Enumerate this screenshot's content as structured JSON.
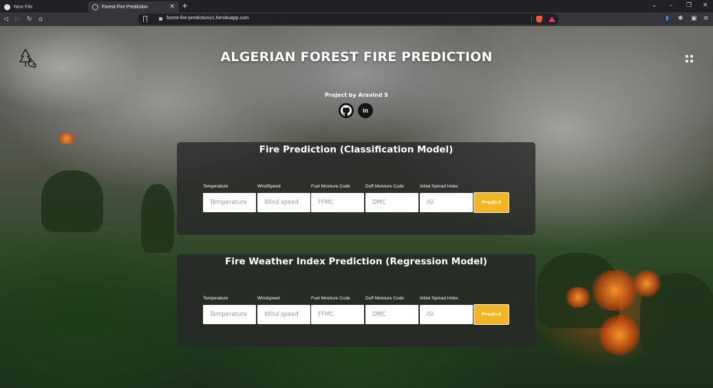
{
  "browser": {
    "tabs": [
      {
        "label": "New File",
        "icon": "github-icon",
        "active": false
      },
      {
        "label": "Forest Fire Prediction",
        "icon": "globe-icon",
        "active": true
      }
    ],
    "url": "forest-fire-predictionv1.herokuapp.com",
    "nav_icons": [
      "back-icon",
      "forward-icon",
      "reload-icon",
      "home-icon",
      "bookmark-icon",
      "lock-icon"
    ],
    "extension_icons": [
      "brave-shields-icon",
      "brave-rewards-icon",
      "audio-icon",
      "extensions-icon",
      "wallet-icon",
      "menu-icon"
    ]
  },
  "page": {
    "title": "ALGERIAN FOREST FIRE PREDICTION",
    "byline": "Project by Aravind S",
    "logo_icon": "forest-fire-logo-icon",
    "menu_icon": "grid-menu-icon",
    "social": [
      {
        "name": "github-icon",
        "glyph": ""
      },
      {
        "name": "linkedin-icon",
        "glyph": "in"
      }
    ],
    "accent_color": "#f5b521"
  },
  "classification": {
    "title": "Fire Prediction (Classification Model)",
    "fields": [
      {
        "label": "Temperature",
        "placeholder": "Temperature"
      },
      {
        "label": "WindSpeed",
        "placeholder": "Wind speed"
      },
      {
        "label": "Fuel Moisture Code",
        "placeholder": "FFMC"
      },
      {
        "label": "Duff Moisture Code",
        "placeholder": "DMC"
      },
      {
        "label": "Initial Spread Index",
        "placeholder": "ISI"
      }
    ],
    "button": "Predict"
  },
  "regression": {
    "title": "Fire Weather Index Prediction (Regression Model)",
    "fields": [
      {
        "label": "Temperature",
        "placeholder": "Temperature"
      },
      {
        "label": "Windspeed",
        "placeholder": "Wind speed"
      },
      {
        "label": "Fuel Moisture Code",
        "placeholder": "FFMC"
      },
      {
        "label": "Duff Moisture Code",
        "placeholder": "DMC"
      },
      {
        "label": "Initial Spread Index",
        "placeholder": "ISI"
      }
    ],
    "button": "Predict"
  }
}
